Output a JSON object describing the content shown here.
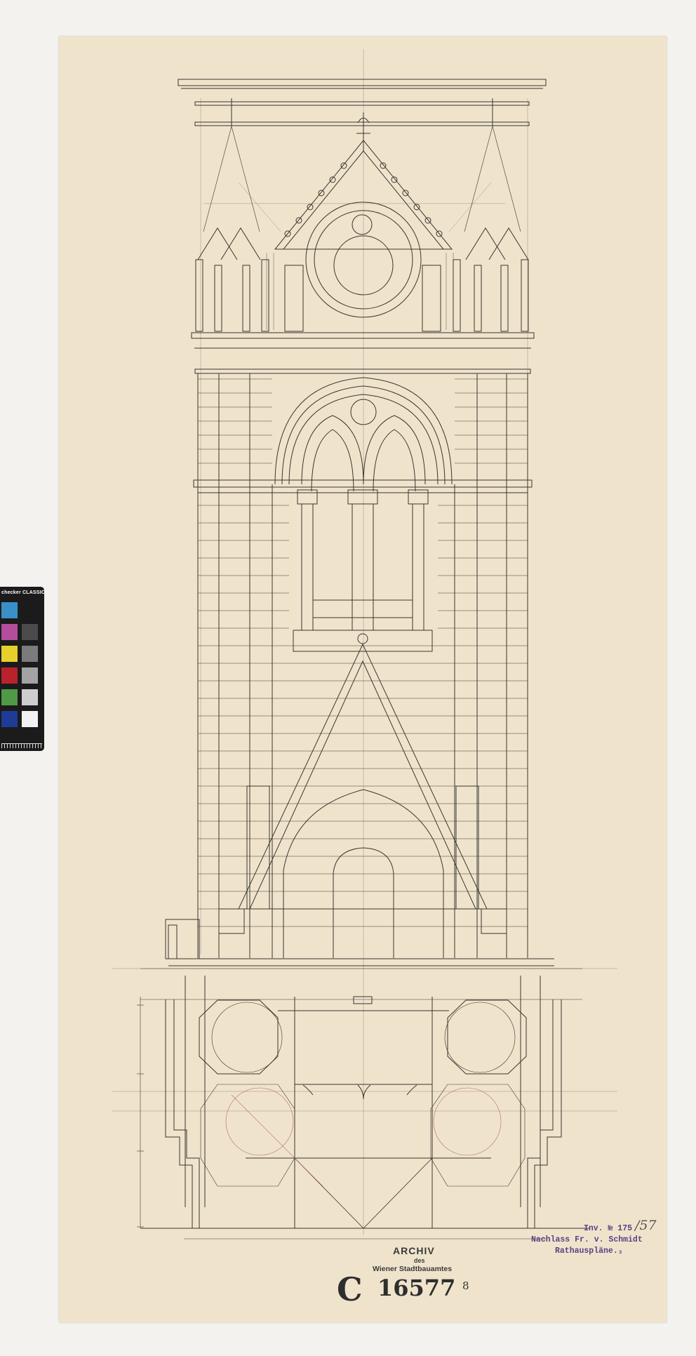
{
  "sheet": {
    "paper_color": "#efe4cb",
    "ink_color": "#3a3530"
  },
  "stamps": {
    "archive_line1": "ARCHIV",
    "archive_line2": "des",
    "archive_line3": "Wiener Stadtbauamtes",
    "collection_letter": "C",
    "collection_number": "16577",
    "sheet_number": "8"
  },
  "inventory": {
    "inv_line": "Inv. № 175",
    "pencil_note": "/57",
    "nachlass_line": "Nachlass Fr. v. Schmidt",
    "rathaus_line": "Rathauspläne.₃",
    "stamp_color": "#5a3f86"
  },
  "color_checker": {
    "title": "checker CLASSIC",
    "swatches_left": [
      "#3b8fc8",
      "#b44e9c",
      "#e7cf2c",
      "#b9222d",
      "#4e9a45",
      "#1f3b96"
    ],
    "swatches_right": [
      "#1b1b1b",
      "#4b4b4b",
      "#7b7b7b",
      "#a3a3a3",
      "#cdcdcd",
      "#f2f2f2"
    ]
  }
}
